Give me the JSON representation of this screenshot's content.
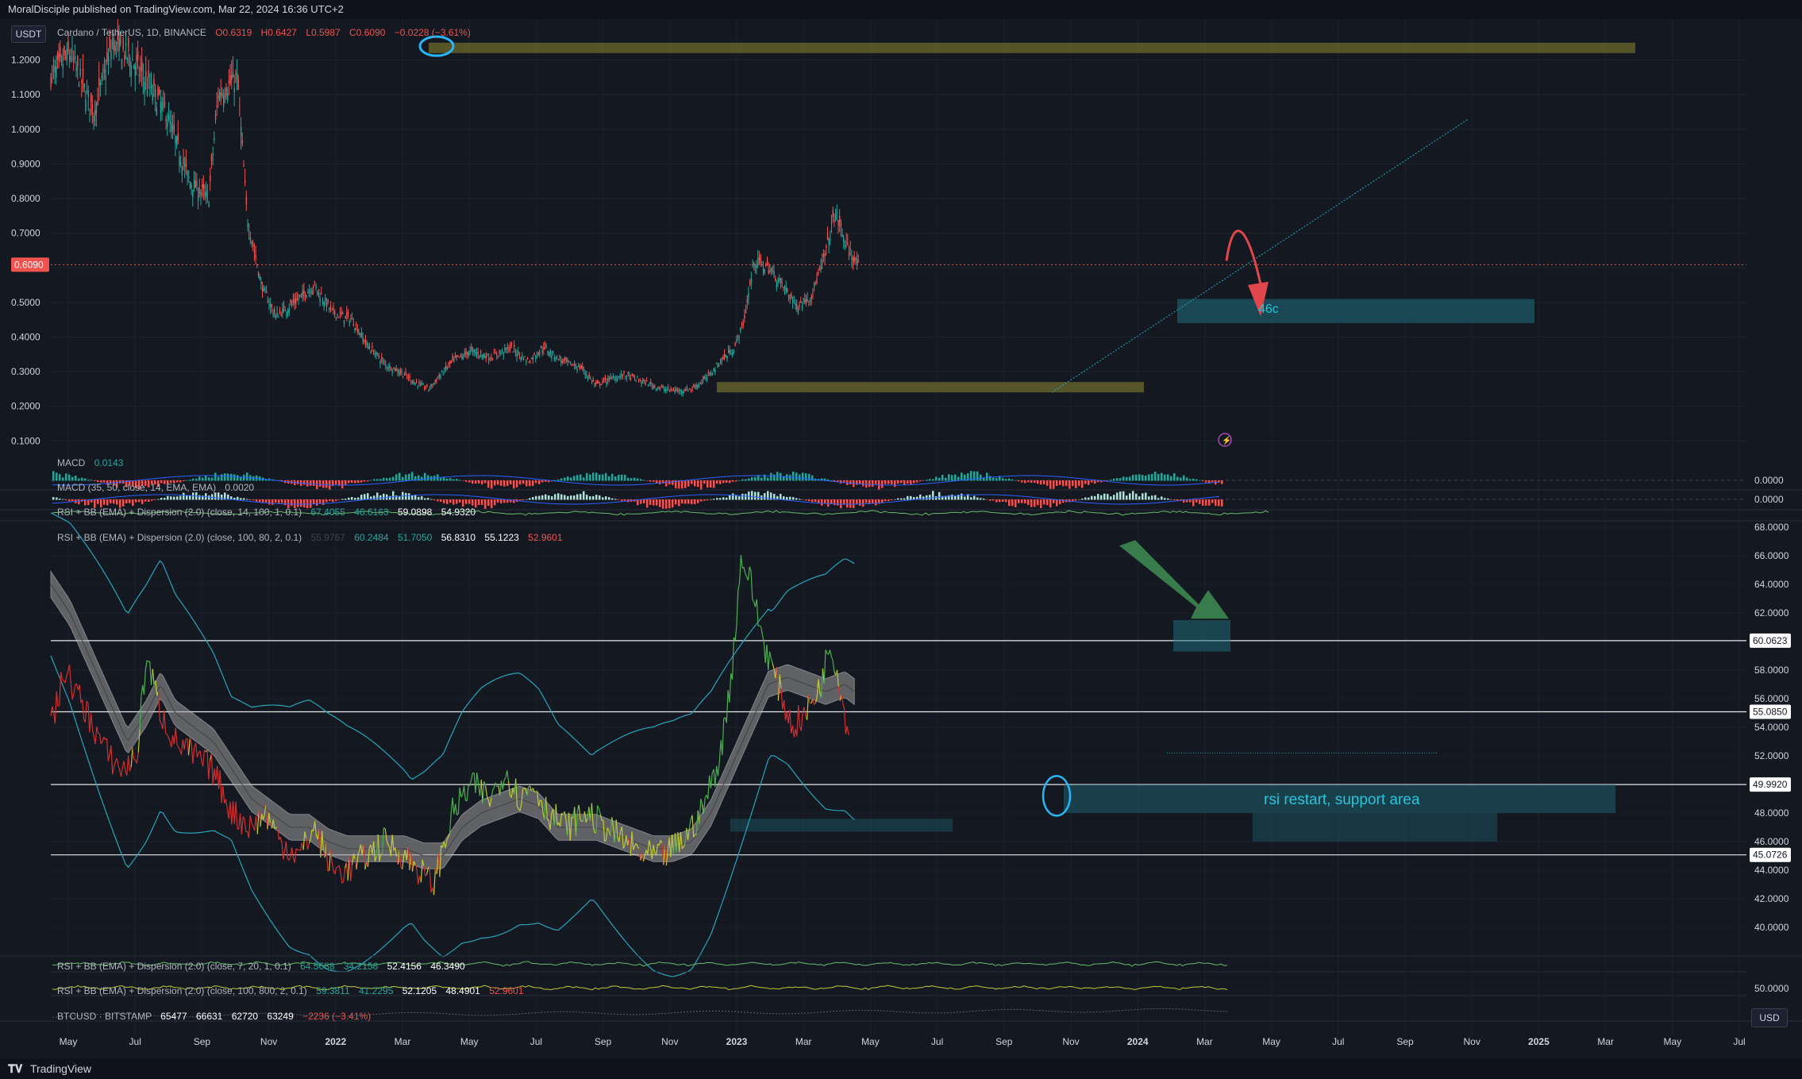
{
  "header": {
    "publisher": "MoralDisciple published on TradingView.com, Mar 22, 2024 16:36 UTC+2"
  },
  "footer": {
    "brand": "TradingView"
  },
  "currency_top": "USDT",
  "currency_bottom": "USD",
  "main_legend": {
    "symbol": "Cardano / TetherUS, 1D, BINANCE",
    "open": "O0.6319",
    "high": "H0.6427",
    "low": "L0.5987",
    "close": "C0.6090",
    "change": "−0.0228 (−3.61%)"
  },
  "indicator_legends": {
    "macd1": "MACD",
    "macd1_value": "0.0143",
    "macd2": "MACD (35, 50, close, 14, EMA, EMA)",
    "macd2_value": "0.0020",
    "rsi_small": "RSI + BB (EMA) + Dispersion (2.0) (close, 14, 100, 1, 0.1)",
    "rsi_small_values": [
      "67.4055",
      "46.6163",
      "59.0898",
      "54.9320"
    ],
    "rsi_main": "RSI + BB (EMA) + Dispersion (2.0) (close, 100, 80, 2, 0.1)",
    "rsi_main_values": [
      "55.9767",
      "60.2484",
      "51.7050",
      "56.8310",
      "55.1223",
      "52.9601"
    ],
    "rsi_b": "RSI + BB (EMA) + Dispersion (2.0) (close, 7, 20, 1, 0.1)",
    "rsi_b_values": [
      "64.5688",
      "34.2158",
      "52.4156",
      "46.3490"
    ],
    "rsi_c": "RSI + BB (EMA) + Dispersion (2.0) (close, 100, 800, 2, 0.1)",
    "rsi_c_values": [
      "59.3811",
      "41.2295",
      "52.1205",
      "48.4901",
      "52.9601"
    ],
    "btc": "BTCUSD · BITSTAMP",
    "btc_values": [
      "65477",
      "66631",
      "62720",
      "63249",
      "−2236 (−3.41%)"
    ]
  },
  "annotations": {
    "target": "46c",
    "rsi_note": "rsi restart, support area"
  },
  "colors": {
    "up": "#26a69a",
    "down": "#ef5350",
    "background": "#141821",
    "zone_yellow": "#6b6a2c",
    "zone_cyan": "#1f6f7f",
    "arrow_red": "#e0474c",
    "arrow_green": "#3e8e52"
  },
  "chart_data": [
    {
      "type": "candlestick",
      "title": "Cardano / TetherUS, 1D, BINANCE",
      "ylim": [
        0.08,
        1.3
      ],
      "y_ticks": [
        "1.2000",
        "1.1000",
        "1.0000",
        "0.9000",
        "0.8000",
        "0.7000",
        "0.6000",
        "0.5000",
        "0.4000",
        "0.3000",
        "0.2000",
        "0.1000"
      ],
      "current_price": "0.6090",
      "x_labels": [
        "May",
        "Jul",
        "Sep",
        "Nov",
        "2022",
        "Mar",
        "May",
        "Jul",
        "Sep",
        "Nov",
        "2023",
        "Mar",
        "May",
        "Jul",
        "Sep",
        "Nov",
        "2024",
        "Mar",
        "May",
        "Jul",
        "Sep",
        "Nov",
        "2025",
        "Mar",
        "May",
        "Jul"
      ],
      "close_path": [
        [
          0,
          1.15
        ],
        [
          20,
          1.22
        ],
        [
          45,
          1.05
        ],
        [
          65,
          1.25
        ],
        [
          85,
          1.2
        ],
        [
          120,
          1.05
        ],
        [
          145,
          0.85
        ],
        [
          165,
          0.8
        ],
        [
          175,
          1.1
        ],
        [
          195,
          1.15
        ],
        [
          205,
          0.75
        ],
        [
          220,
          0.55
        ],
        [
          235,
          0.46
        ],
        [
          255,
          0.5
        ],
        [
          275,
          0.55
        ],
        [
          295,
          0.47
        ],
        [
          315,
          0.45
        ],
        [
          330,
          0.38
        ],
        [
          350,
          0.32
        ],
        [
          365,
          0.3
        ],
        [
          380,
          0.27
        ],
        [
          395,
          0.25
        ],
        [
          420,
          0.33
        ],
        [
          440,
          0.36
        ],
        [
          460,
          0.34
        ],
        [
          480,
          0.37
        ],
        [
          500,
          0.33
        ],
        [
          515,
          0.37
        ],
        [
          535,
          0.33
        ],
        [
          555,
          0.31
        ],
        [
          570,
          0.26
        ],
        [
          585,
          0.28
        ],
        [
          600,
          0.29
        ],
        [
          620,
          0.27
        ],
        [
          640,
          0.25
        ],
        [
          655,
          0.245
        ],
        [
          670,
          0.25
        ],
        [
          685,
          0.28
        ],
        [
          700,
          0.33
        ],
        [
          715,
          0.37
        ],
        [
          725,
          0.45
        ],
        [
          735,
          0.62
        ],
        [
          750,
          0.6
        ],
        [
          765,
          0.55
        ],
        [
          780,
          0.49
        ],
        [
          795,
          0.52
        ],
        [
          808,
          0.62
        ],
        [
          820,
          0.76
        ],
        [
          832,
          0.66
        ],
        [
          845,
          0.6
        ]
      ],
      "x_domain_days": [
        0,
        1160
      ],
      "support_zone_low": [
        0.24,
        0.27
      ],
      "support_zone_high": [
        1.22,
        1.25
      ],
      "target_zone": [
        0.44,
        0.51
      ]
    },
    {
      "type": "line",
      "title": "RSI + BB (EMA) + Dispersion (2.0) (close, 100, 80, 2, 0.1)",
      "ylim": [
        38,
        68
      ],
      "y_ticks": [
        "68.0000",
        "66.0000",
        "64.0000",
        "62.0000",
        "60.0000",
        "58.0000",
        "56.0000",
        "54.0000",
        "52.0000",
        "50.0000",
        "48.0000",
        "46.0000",
        "44.0000",
        "42.0000",
        "40.0000"
      ],
      "horizontal_levels": [
        "60.0623",
        "55.0850",
        "49.9920",
        "45.0726"
      ],
      "rsi_path": [
        [
          0,
          54
        ],
        [
          15,
          58
        ],
        [
          30,
          56
        ],
        [
          45,
          54
        ],
        [
          60,
          52
        ],
        [
          75,
          51
        ],
        [
          90,
          52
        ],
        [
          100,
          59
        ],
        [
          115,
          55
        ],
        [
          130,
          53
        ],
        [
          150,
          52
        ],
        [
          170,
          51
        ],
        [
          190,
          48
        ],
        [
          210,
          47
        ],
        [
          225,
          48
        ],
        [
          240,
          46
        ],
        [
          260,
          45
        ],
        [
          275,
          47
        ],
        [
          295,
          44
        ],
        [
          310,
          44
        ],
        [
          330,
          45
        ],
        [
          350,
          46
        ],
        [
          370,
          45
        ],
        [
          385,
          44
        ],
        [
          400,
          43
        ],
        [
          420,
          48
        ],
        [
          440,
          50
        ],
        [
          460,
          49
        ],
        [
          475,
          51
        ],
        [
          490,
          49
        ],
        [
          505,
          50
        ],
        [
          520,
          48
        ],
        [
          540,
          47
        ],
        [
          560,
          48
        ],
        [
          580,
          47
        ],
        [
          600,
          46
        ],
        [
          620,
          45
        ],
        [
          640,
          45
        ],
        [
          660,
          46
        ],
        [
          680,
          48
        ],
        [
          700,
          52
        ],
        [
          712,
          58
        ],
        [
          722,
          66
        ],
        [
          732,
          64
        ],
        [
          745,
          60
        ],
        [
          760,
          57
        ],
        [
          775,
          54
        ],
        [
          790,
          55
        ],
        [
          805,
          57
        ],
        [
          815,
          60
        ],
        [
          822,
          58
        ],
        [
          830,
          55
        ],
        [
          835,
          53
        ]
      ],
      "basis_path": [
        [
          0,
          64
        ],
        [
          20,
          62
        ],
        [
          40,
          59
        ],
        [
          60,
          56
        ],
        [
          80,
          53
        ],
        [
          100,
          55
        ],
        [
          115,
          57
        ],
        [
          130,
          55
        ],
        [
          150,
          54
        ],
        [
          170,
          53
        ],
        [
          190,
          51
        ],
        [
          210,
          49
        ],
        [
          230,
          48
        ],
        [
          250,
          47
        ],
        [
          270,
          47
        ],
        [
          290,
          46
        ],
        [
          310,
          45.5
        ],
        [
          330,
          45.5
        ],
        [
          350,
          45.5
        ],
        [
          370,
          45.5
        ],
        [
          390,
          45
        ],
        [
          410,
          45
        ],
        [
          430,
          47
        ],
        [
          450,
          48
        ],
        [
          470,
          48.5
        ],
        [
          490,
          49
        ],
        [
          510,
          48.5
        ],
        [
          530,
          47
        ],
        [
          550,
          47
        ],
        [
          570,
          47
        ],
        [
          590,
          46.5
        ],
        [
          610,
          46
        ],
        [
          630,
          45.5
        ],
        [
          650,
          45.5
        ],
        [
          670,
          46
        ],
        [
          690,
          48
        ],
        [
          710,
          51
        ],
        [
          730,
          54
        ],
        [
          750,
          57
        ],
        [
          770,
          57.5
        ],
        [
          790,
          57
        ],
        [
          810,
          56.5
        ],
        [
          830,
          57
        ],
        [
          840,
          56.5
        ]
      ]
    }
  ]
}
